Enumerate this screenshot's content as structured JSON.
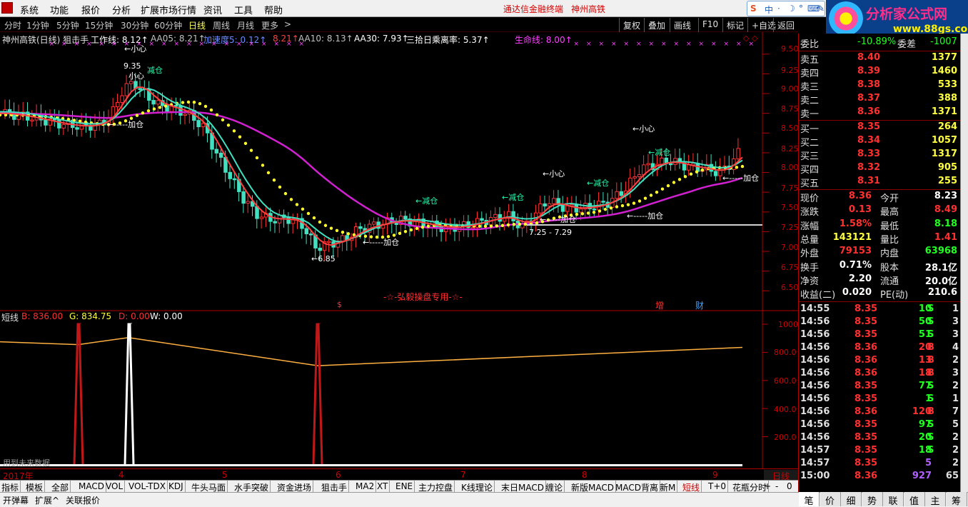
{
  "menu": {
    "items": [
      "系统",
      "功能",
      "报价",
      "分析",
      "扩展市场行情",
      "资讯",
      "工具",
      "帮助"
    ],
    "brand": "通达信金融终端",
    "stock": "神州高铁"
  },
  "ime": {
    "labels": [
      "S",
      "中",
      "·",
      "☽",
      "°",
      "⌨",
      "✎"
    ]
  },
  "logo": {
    "text": "分析家公式网",
    "url": "www.88gs.com"
  },
  "toolbar": {
    "periods": [
      "分时",
      "1分钟",
      "5分钟",
      "15分钟",
      "30分钟",
      "60分钟",
      "日线",
      "周线",
      "月线",
      "更多",
      ">"
    ],
    "active_period": "日线",
    "buttons": [
      "复权",
      "叠加",
      "画线",
      "F10",
      "标记",
      "+自选",
      "返回"
    ]
  },
  "header": {
    "title": "神州高铁(日线) 狙击手",
    "items": [
      {
        "label": "工作线: 8.12↑",
        "color": "#ffffff"
      },
      {
        "label": "AA05: 8.21↑",
        "color": "#c0c0c0"
      },
      {
        "label": "加速度5: 0.12↑",
        "color": "#6a8cff"
      },
      {
        "label": "8.21↑",
        "color": "#ff4040"
      },
      {
        "label": "AA10: 8.13↑",
        "color": "#c0c0c0"
      },
      {
        "label": "AA30: 7.93↑",
        "color": "#ffffff"
      },
      {
        "label": "三拾日乘离率: 5.37↑",
        "color": "#ffffff"
      },
      {
        "label": "生命线: 8.00↑",
        "color": "#ff40ff"
      }
    ]
  },
  "main_chart": {
    "y_ticks": [
      "9.50",
      "9.25",
      "9.00",
      "8.75",
      "8.50",
      "8.25",
      "8.00",
      "7.75",
      "7.50",
      "7.25",
      "7.00",
      "6.75",
      "6.50"
    ],
    "annotations": [
      {
        "text": "←小心",
        "color": "#ffffff"
      },
      {
        "text": "9.35",
        "color": "#ffffff"
      },
      {
        "text": "小心",
        "color": "#ffffff"
      },
      {
        "text": "减仓",
        "color": "#20ffb0"
      },
      {
        "text": "←-----加仓",
        "color": "#ffffff"
      },
      {
        "text": "←-----加仓",
        "color": "#ffffff"
      },
      {
        "text": "←6.85",
        "color": "#ffffff"
      },
      {
        "text": "←减仓",
        "color": "#20ffb0"
      },
      {
        "text": "←减仓",
        "color": "#20ffb0"
      },
      {
        "text": "←小心",
        "color": "#ffffff"
      },
      {
        "text": "←减仓",
        "color": "#20ffb0"
      },
      {
        "text": "←-----加仓",
        "color": "#ffffff"
      },
      {
        "text": "7.25 - 7.29",
        "color": "#ffffff"
      },
      {
        "text": "←小心",
        "color": "#ffffff"
      },
      {
        "text": "←减仓",
        "color": "#20ffb0"
      },
      {
        "text": "←-----加仓",
        "color": "#ffffff"
      },
      {
        "text": "←-----加仓",
        "color": "#ffffff"
      }
    ],
    "watermark": "-☆-弘毅操盘专用-☆-",
    "markers": [
      {
        "text": "$",
        "color": "#ff3030"
      },
      {
        "text": "增",
        "color": "#ff3030"
      },
      {
        "text": "财",
        "color": "#40a0ff"
      }
    ]
  },
  "chart_data": {
    "type": "line",
    "title": "短线",
    "legend": [
      {
        "label": "B: 836.00",
        "color": "#ff3030"
      },
      {
        "label": "G: 834.75",
        "color": "#ffff40"
      },
      {
        "label": "D: 0.00",
        "color": "#ff3030"
      },
      {
        "label": "W: 0.00",
        "color": "#ffffff"
      }
    ],
    "x_labels": [
      "2017年",
      "4",
      "5",
      "6",
      "7",
      "8",
      "9"
    ],
    "y_ticks": [
      "1000",
      "800.0",
      "600.0",
      "400.0",
      "200.0"
    ],
    "ylim": [
      0,
      1000
    ],
    "series": [
      {
        "name": "G",
        "color": "#ffb040",
        "x": [
          0,
          110,
          180,
          445,
          1040
        ],
        "values": [
          875,
          855,
          905,
          705,
          835
        ]
      },
      {
        "name": "B",
        "color": "#c01818",
        "type": "spike",
        "x": [
          110,
          445
        ],
        "values": [
          1000,
          1000
        ]
      },
      {
        "name": "W",
        "color": "#ffffff",
        "type": "spike",
        "x": [
          181
        ],
        "values": [
          1000
        ]
      }
    ],
    "note": "用到未来数据"
  },
  "period_label": "日线",
  "indicator_tabs": [
    "指标",
    "模板",
    "全部",
    "MACD",
    "VOL",
    "VOL-TDX",
    "KDJ",
    "牛头马面",
    "水手突破",
    "资金进场",
    "狙击手",
    "MA2",
    "XT",
    "ENE",
    "主力控盘",
    "K线理论",
    "末日MACD",
    "缠论",
    "新版MACD",
    "MACD背离",
    "新M",
    "短线",
    "T+0",
    "花瓶分时",
    "+",
    "-",
    "0"
  ],
  "active_indicator": "短线",
  "bottom_bar": [
    "开弹幕",
    "扩展^",
    "关联报价"
  ],
  "quote": {
    "committee": {
      "label": "委比",
      "ratio": "-10.89%",
      "diff_label": "委差",
      "diff": "-1007"
    },
    "asks": [
      {
        "label": "卖五",
        "price": "8.40",
        "vol": "1377"
      },
      {
        "label": "卖四",
        "price": "8.39",
        "vol": "1460"
      },
      {
        "label": "卖三",
        "price": "8.38",
        "vol": "533"
      },
      {
        "label": "卖二",
        "price": "8.37",
        "vol": "388"
      },
      {
        "label": "卖一",
        "price": "8.36",
        "vol": "1371"
      }
    ],
    "bids": [
      {
        "label": "买一",
        "price": "8.35",
        "vol": "264"
      },
      {
        "label": "买二",
        "price": "8.34",
        "vol": "1057"
      },
      {
        "label": "买三",
        "price": "8.33",
        "vol": "1317"
      },
      {
        "label": "买四",
        "price": "8.32",
        "vol": "905"
      },
      {
        "label": "买五",
        "price": "8.31",
        "vol": "255"
      }
    ],
    "stats": [
      {
        "l1": "现价",
        "v1": "8.36",
        "c1": "#ff3030",
        "l2": "今开",
        "v2": "8.23",
        "c2": "#ffffff"
      },
      {
        "l1": "涨跌",
        "v1": "0.13",
        "c1": "#ff3030",
        "l2": "最高",
        "v2": "8.49",
        "c2": "#ff3030"
      },
      {
        "l1": "涨幅",
        "v1": "1.58%",
        "c1": "#ff3030",
        "l2": "最低",
        "v2": "8.18",
        "c2": "#20ff20"
      },
      {
        "l1": "总量",
        "v1": "143121",
        "c1": "#ffff40",
        "l2": "量比",
        "v2": "1.41",
        "c2": "#ff3030"
      },
      {
        "l1": "外盘",
        "v1": "79153",
        "c1": "#ff3030",
        "l2": "内盘",
        "v2": "63968",
        "c2": "#20ff20"
      },
      {
        "l1": "换手",
        "v1": "0.71%",
        "c1": "#ffffff",
        "l2": "股本",
        "v2": "28.1亿",
        "c2": "#ffffff"
      },
      {
        "l1": "净资",
        "v1": "2.20",
        "c1": "#ffffff",
        "l2": "流通",
        "v2": "20.0亿",
        "c2": "#ffffff"
      },
      {
        "l1": "收益(二)",
        "v1": "0.020",
        "c1": "#ffffff",
        "l2": "PE(动)",
        "v2": "210.6",
        "c2": "#ffffff"
      }
    ],
    "ticks": [
      {
        "time": "14:55",
        "price": "8.35",
        "vol": "10",
        "side": "S",
        "n": "1"
      },
      {
        "time": "14:56",
        "price": "8.35",
        "vol": "50",
        "side": "S",
        "n": "3"
      },
      {
        "time": "14:56",
        "price": "8.35",
        "vol": "51",
        "side": "S",
        "n": "3"
      },
      {
        "time": "14:56",
        "price": "8.36",
        "vol": "20",
        "side": "B",
        "n": "4"
      },
      {
        "time": "14:56",
        "price": "8.36",
        "vol": "13",
        "side": "B",
        "n": "2"
      },
      {
        "time": "14:56",
        "price": "8.36",
        "vol": "18",
        "side": "B",
        "n": "3"
      },
      {
        "time": "14:56",
        "price": "8.35",
        "vol": "77",
        "side": "S",
        "n": "2"
      },
      {
        "time": "14:56",
        "price": "8.35",
        "vol": "1",
        "side": "S",
        "n": "1"
      },
      {
        "time": "14:56",
        "price": "8.36",
        "vol": "120",
        "side": "B",
        "n": "7"
      },
      {
        "time": "14:56",
        "price": "8.35",
        "vol": "97",
        "side": "S",
        "n": "5"
      },
      {
        "time": "14:56",
        "price": "8.35",
        "vol": "20",
        "side": "S",
        "n": "2"
      },
      {
        "time": "14:57",
        "price": "8.35",
        "vol": "18",
        "side": "S",
        "n": "2"
      },
      {
        "time": "14:57",
        "price": "8.35",
        "vol": "5",
        "side": "",
        "n": "2"
      },
      {
        "time": "15:00",
        "price": "8.36",
        "vol": "927",
        "side": "",
        "n": "65"
      }
    ],
    "tabs": [
      "笔",
      "价",
      "细",
      "势",
      "联",
      "值",
      "主",
      "筹"
    ]
  }
}
